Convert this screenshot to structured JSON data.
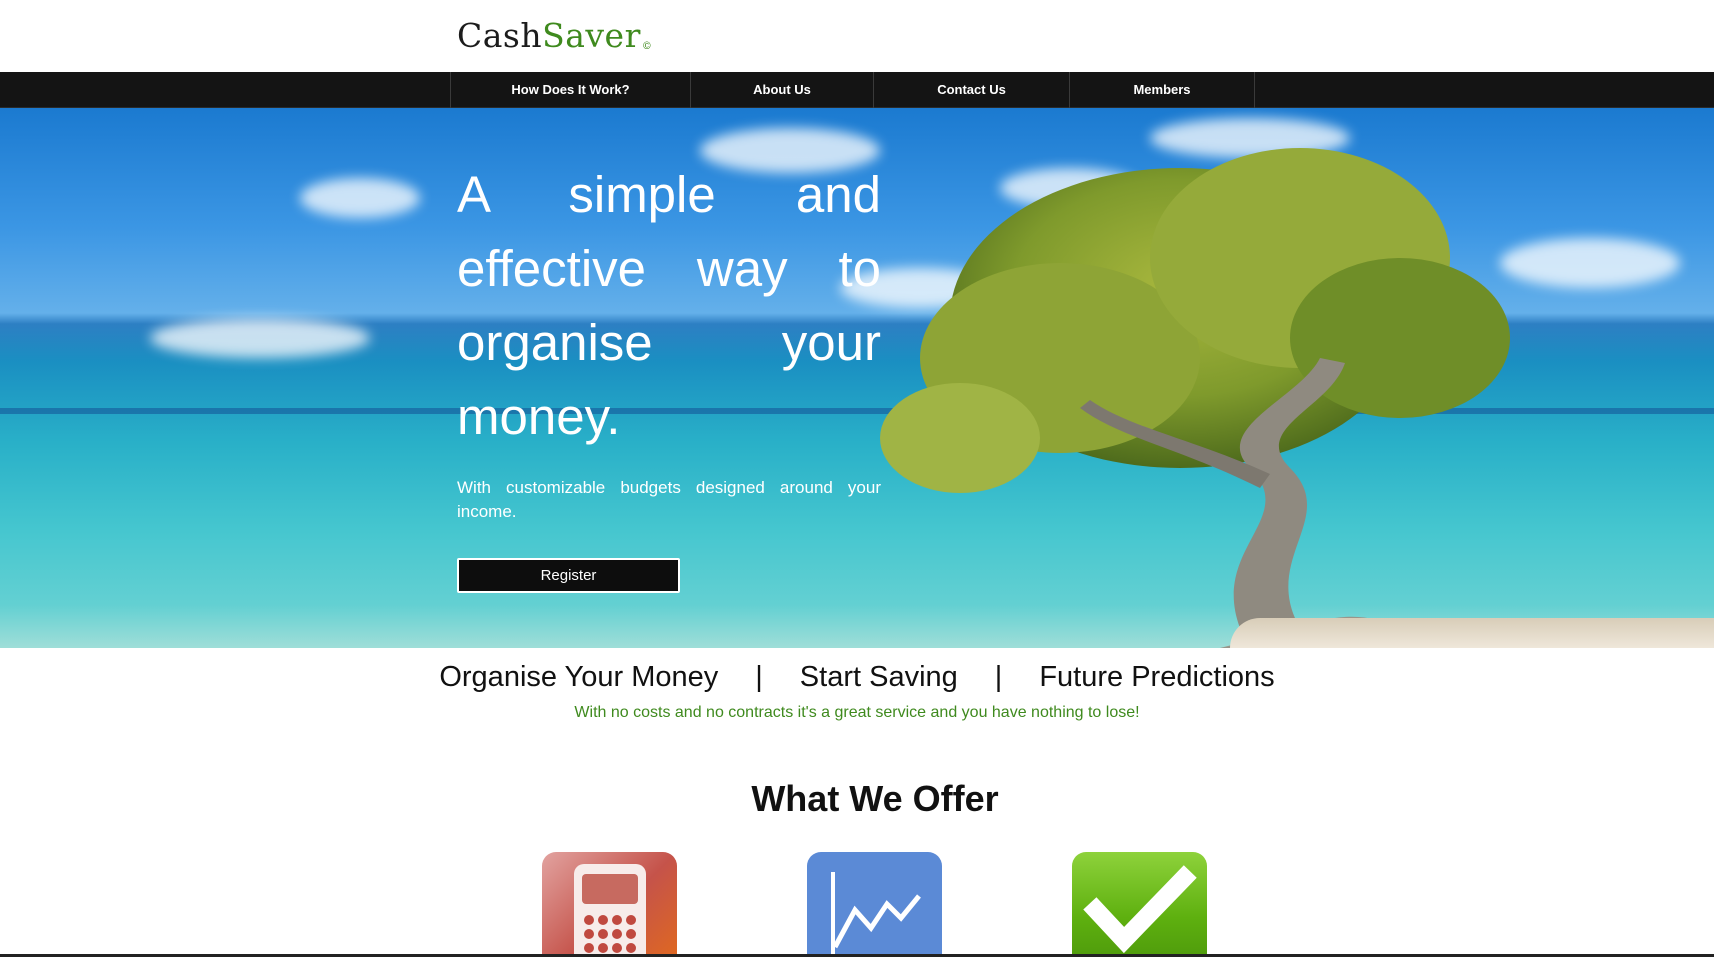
{
  "brand": {
    "part1": "Cash",
    "part2": "Saver",
    "mark": "©",
    "colors": {
      "dark": "#1c1c1c",
      "green": "#3f8a1e"
    }
  },
  "nav": {
    "items": [
      {
        "label": "How Does It Work?"
      },
      {
        "label": "About Us"
      },
      {
        "label": "Contact Us"
      },
      {
        "label": "Members"
      }
    ]
  },
  "hero": {
    "title": "A simple and effective way to organise your money.",
    "subtitle": "With customizable budgets designed around your income.",
    "register_label": "Register",
    "background": "beach-with-divi-tree"
  },
  "taglines": {
    "items": [
      "Organise Your Money",
      "Start Saving",
      "Future Predictions"
    ],
    "separator": "|",
    "promo": "With no costs and no contracts it's a great service and you have nothing to lose!"
  },
  "offer": {
    "title": "What We Offer",
    "tiles": [
      {
        "icon": "calculator-icon"
      },
      {
        "icon": "line-chart-icon"
      },
      {
        "icon": "checkmark-icon"
      }
    ]
  }
}
